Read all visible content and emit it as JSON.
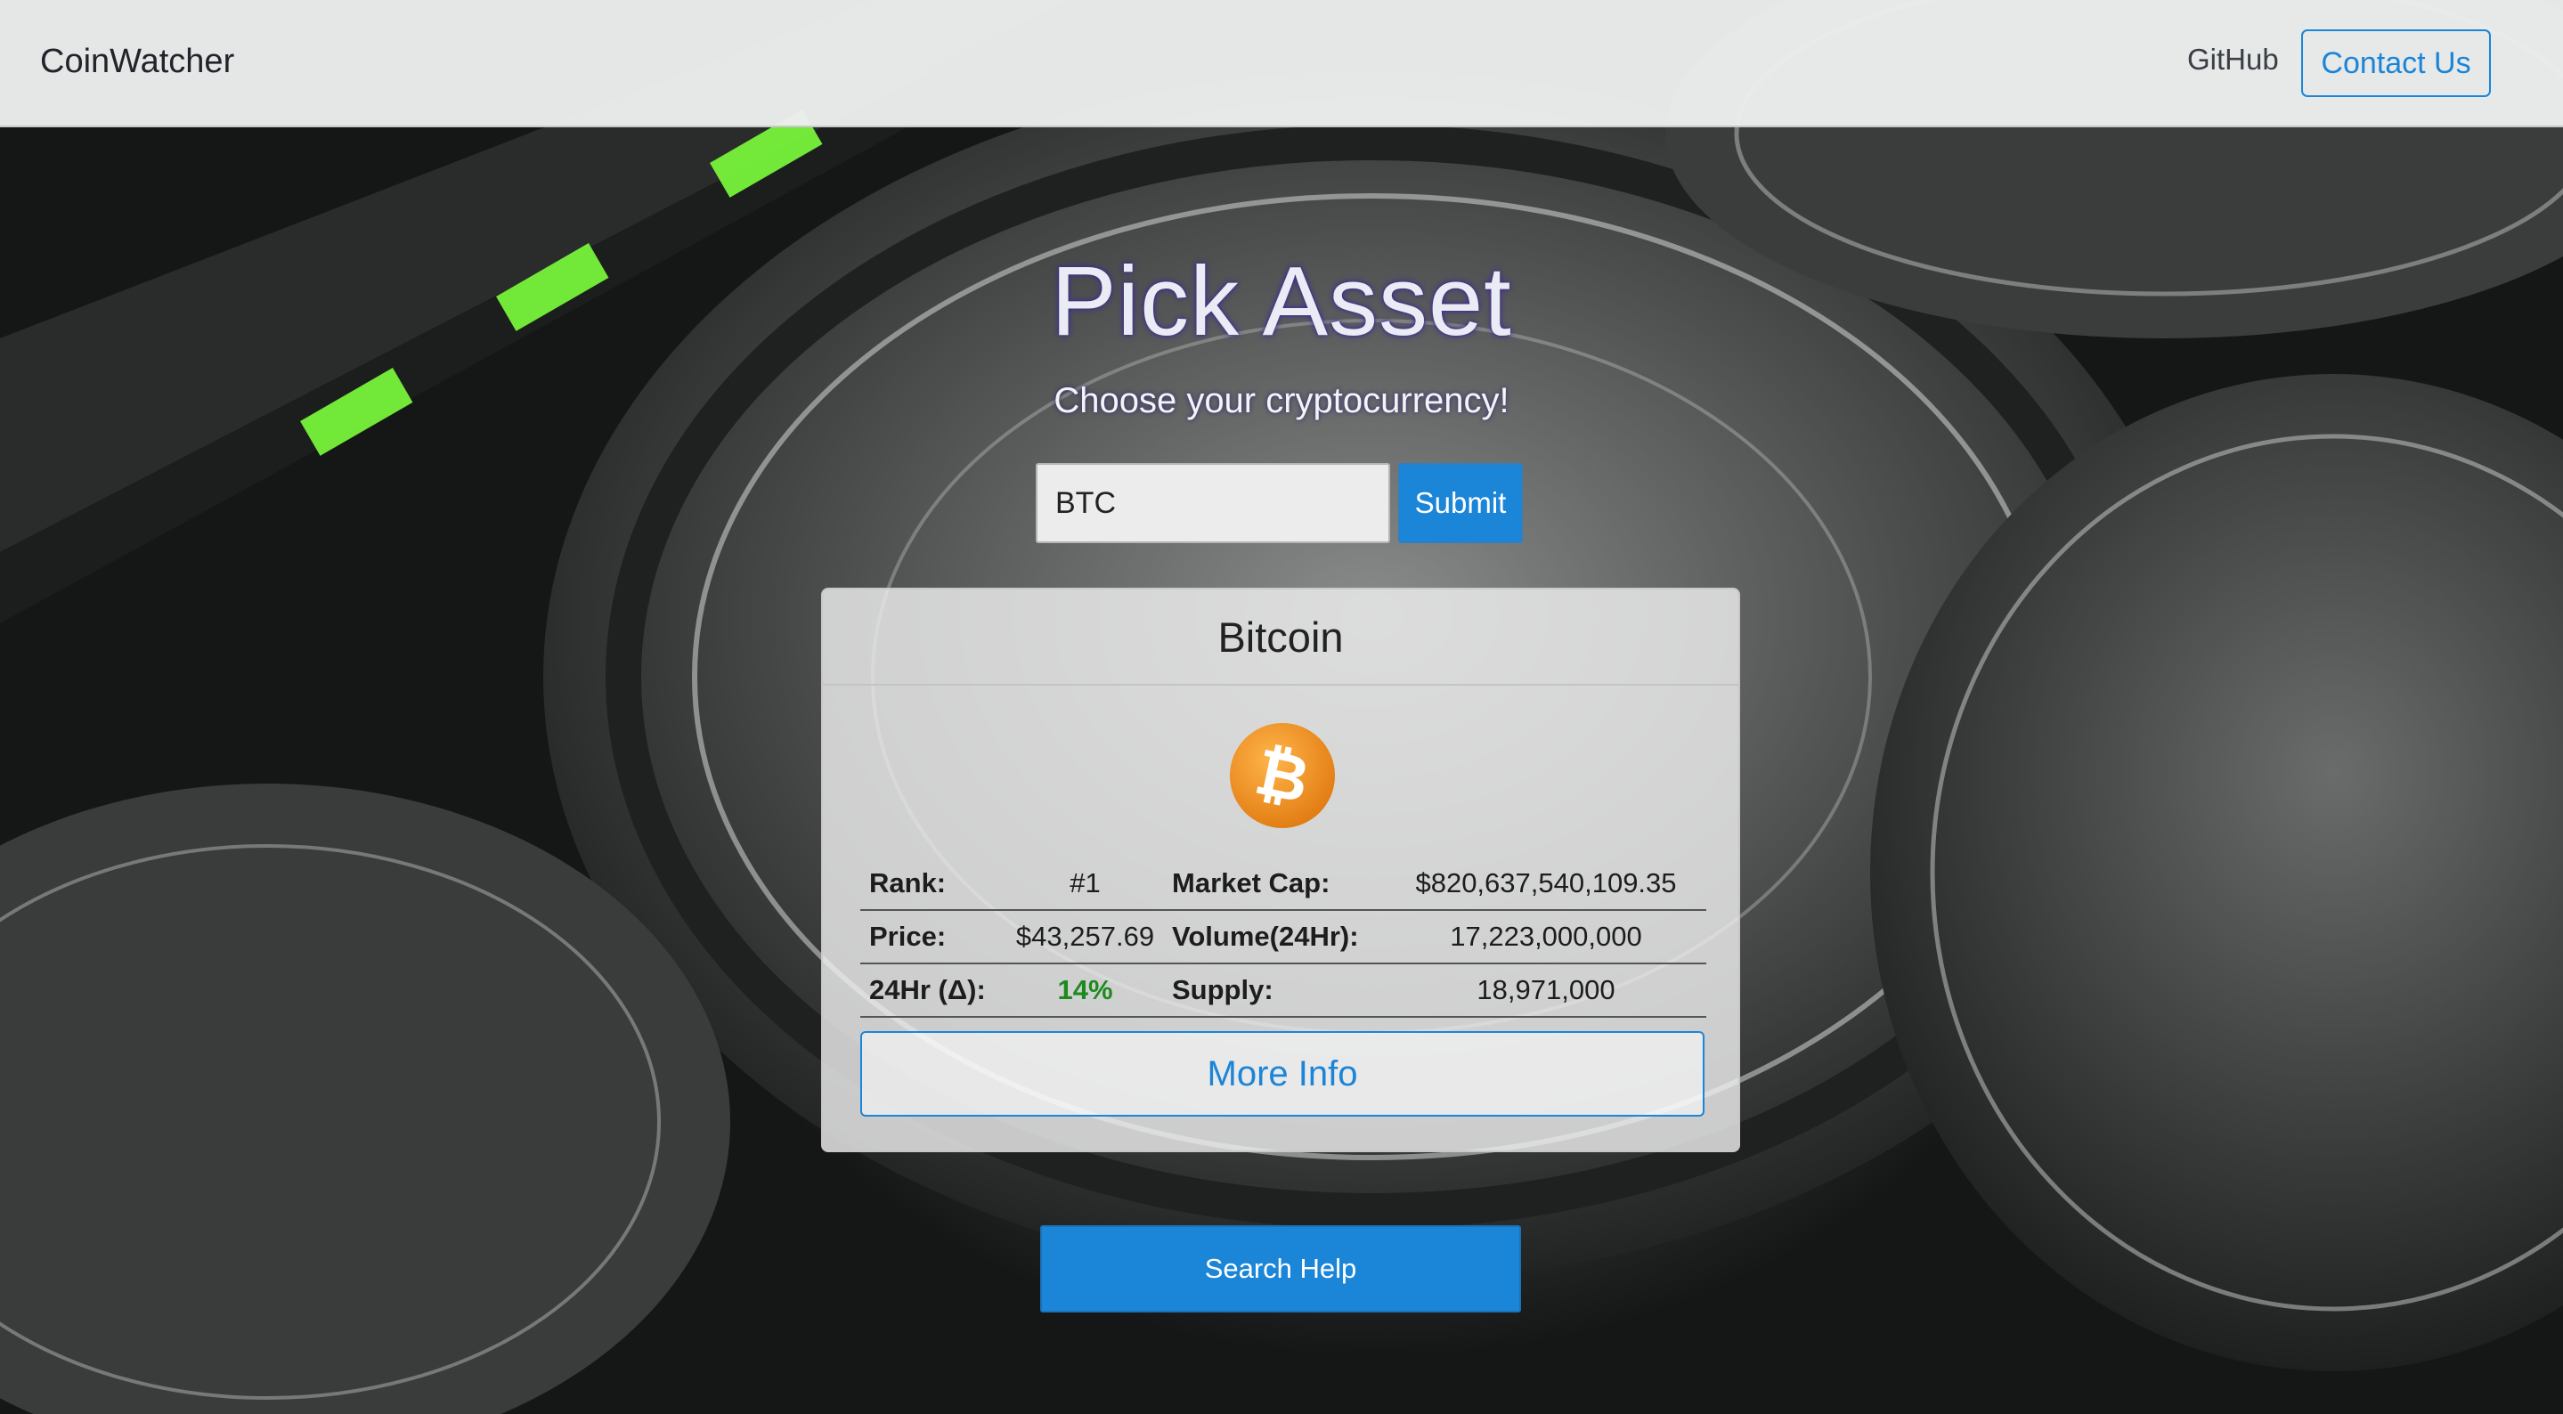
{
  "navbar": {
    "brand": "CoinWatcher",
    "github_label": "GitHub",
    "contact_label": "Contact Us"
  },
  "hero": {
    "title": "Pick Asset",
    "subtitle": "Choose your cryptocurrency!"
  },
  "search": {
    "value": "BTC",
    "submit_label": "Submit"
  },
  "asset_card": {
    "name": "Bitcoin",
    "icon": "bitcoin-logo-icon",
    "stats": {
      "rank_label": "Rank:",
      "rank_value": "#1",
      "market_cap_label": "Market Cap:",
      "market_cap_value": "$820,637,540,109.35",
      "price_label": "Price:",
      "price_value": "$43,257.69",
      "volume_label": "Volume(24Hr):",
      "volume_value": "17,223,000,000",
      "change_label": "24Hr (Δ):",
      "change_value": "14%",
      "supply_label": "Supply:",
      "supply_value": "18,971,000"
    },
    "more_info_label": "More Info"
  },
  "search_help_label": "Search Help",
  "colors": {
    "accent": "#1b85d8",
    "positive_change": "#1e8a1e",
    "bitcoin_orange": "#f7931a",
    "highlight_green": "#6cff3a"
  }
}
